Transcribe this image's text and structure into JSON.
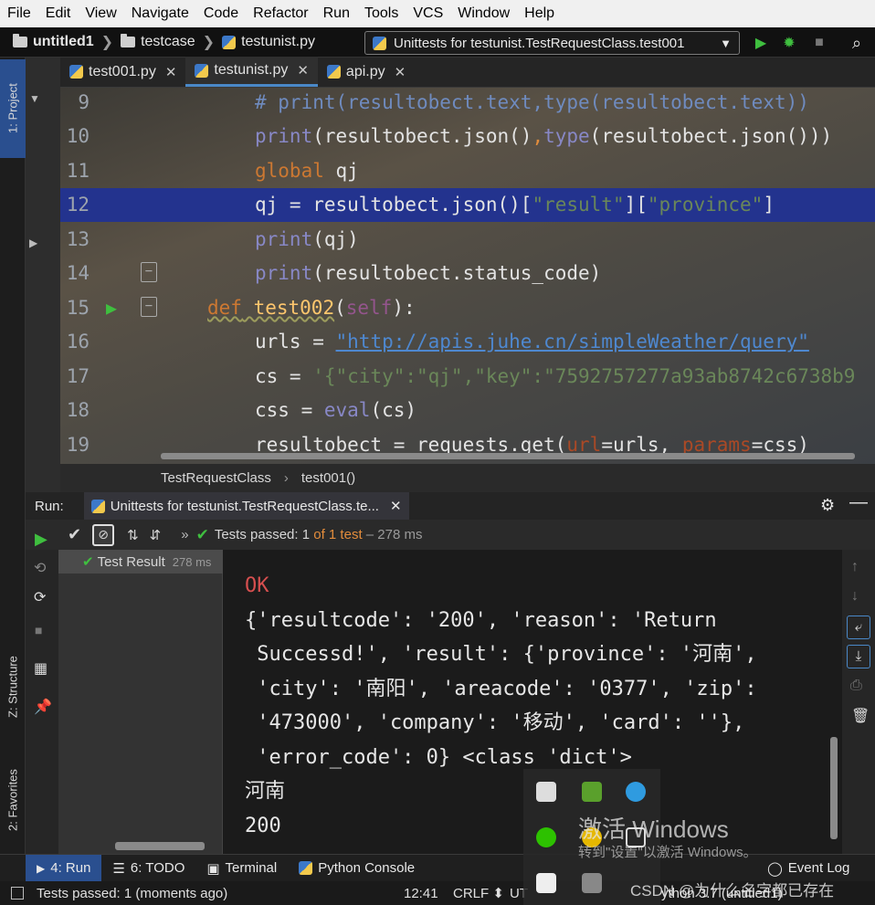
{
  "menu": [
    "File",
    "Edit",
    "View",
    "Navigate",
    "Code",
    "Refactor",
    "Run",
    "Tools",
    "VCS",
    "Window",
    "Help"
  ],
  "nav": {
    "project": "untitled1",
    "folder": "testcase",
    "file": "testunist.py"
  },
  "run_config": "Unittests for testunist.TestRequestClass.test001",
  "tabs": [
    {
      "label": "test001.py"
    },
    {
      "label": "testunist.py"
    },
    {
      "label": "api.py"
    }
  ],
  "left_tool_tabs": {
    "project": "1: Project",
    "structure": "Z: Structure",
    "favorites": "2: Favorites"
  },
  "code_lines": [
    {
      "n": "9"
    },
    {
      "n": "10"
    },
    {
      "n": "11"
    },
    {
      "n": "12"
    },
    {
      "n": "13"
    },
    {
      "n": "14"
    },
    {
      "n": "15"
    },
    {
      "n": "16"
    },
    {
      "n": "17"
    },
    {
      "n": "18"
    },
    {
      "n": "19"
    }
  ],
  "code": {
    "l9": "# print(resultobect.text,type(resultobect.text))",
    "l10a": "print",
    "l10b": "(resultobect.json()",
    "l10c": ",",
    "l10d": "type",
    "l10e": "(resultobect.json()))",
    "l11a": "global",
    "l11b": " qj",
    "l12a": "qj = resultobect.json()[",
    "l12b": "\"result\"",
    "l12c": "][",
    "l12d": "\"province\"",
    "l12e": "]",
    "l13a": "print",
    "l13b": "(qj)",
    "l14a": "print",
    "l14b": "(resultobect.status_code)",
    "l15a": "def",
    "l15b": " test002",
    "l15c": "(",
    "l15d": "self",
    "l15e": "):",
    "l16a": "urls = ",
    "l16b": "\"http://apis.juhe.cn/simpleWeather/query\"",
    "l17a": "cs = ",
    "l17b": "'{\"city\":\"qj\",\"key\":\"7592757277a93ab8742c6738b9",
    "l18a": "css = ",
    "l18b": "eval",
    "l18c": "(cs)",
    "l19a": "resultobect = requests.get(",
    "l19b": "url",
    "l19c": "=urls, ",
    "l19d": "params",
    "l19e": "=css)"
  },
  "editor_crumb": {
    "class": "TestRequestClass",
    "method": "test001()"
  },
  "run": {
    "label": "Run:",
    "tab": "Unittests for testunist.TestRequestClass.te...",
    "status_prefix": "Tests passed:",
    "passed": "1",
    "of_text": "of 1 test",
    "time": "– 278 ms",
    "tree_label": "Test Result",
    "tree_time": "278 ms"
  },
  "console_lines": [
    "OK",
    "{'resultcode': '200', 'reason': 'Return",
    " Successd!', 'result': {'province': '河南',",
    " 'city': '南阳', 'areacode': '0377', 'zip':",
    " '473000', 'company': '移动', 'card': ''},",
    " 'error_code': 0} <class 'dict'>",
    "河南",
    "200"
  ],
  "bottom_tabs": [
    {
      "label": "4: Run"
    },
    {
      "label": "6: TODO"
    },
    {
      "label": "Terminal"
    },
    {
      "label": "Python Console"
    }
  ],
  "event_log": "Event Log",
  "status": {
    "message": "Tests passed: 1 (moments ago)",
    "position": "12:41",
    "line_sep": "CRLF",
    "encoding": "UT",
    "interpreter": "ython 3.7 (untitled1)"
  },
  "watermark": {
    "title": "激活 Windows",
    "subtitle": "转到\"设置\"以激活 Windows。"
  },
  "csdn": "CSDN @为什么名字都已存在",
  "colors": {
    "accent": "#4a88c7",
    "run_green": "#3fbf3f",
    "line_highlight": "#23338e"
  }
}
